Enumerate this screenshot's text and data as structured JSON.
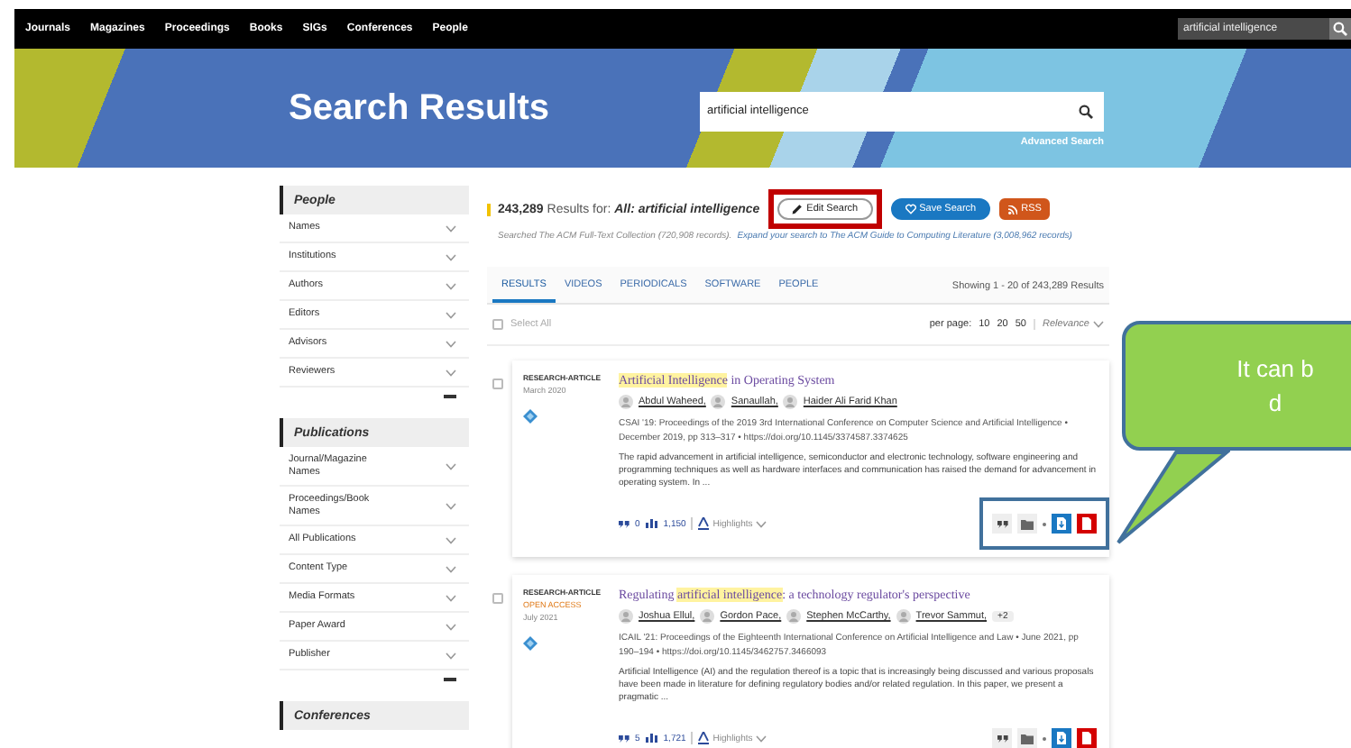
{
  "nav": {
    "links": [
      "Journals",
      "Magazines",
      "Proceedings",
      "Books",
      "SIGs",
      "Conferences",
      "People"
    ],
    "search": {
      "value": "artificial intelligence"
    }
  },
  "banner": {
    "title": "Search Results",
    "search": {
      "value": "artificial intelligence"
    },
    "advanced_link": "Advanced Search"
  },
  "sidebar": {
    "sections": [
      {
        "heading": "People",
        "items": [
          "Names",
          "Institutions",
          "Authors",
          "Editors",
          "Advisors",
          "Reviewers"
        ]
      },
      {
        "heading": "Publications",
        "items": [
          "Journal/Magazine Names",
          "Proceedings/Book Names",
          "All Publications",
          "Content Type",
          "Media Formats",
          "Paper Award",
          "Publisher"
        ]
      },
      {
        "heading": "Conferences"
      }
    ]
  },
  "results": {
    "count": "243,289",
    "label": "Results for:",
    "query": "All: artificial intelligence",
    "buttons": [
      {
        "label": "Edit Search",
        "kind": "edit",
        "highlighted": true
      },
      {
        "label": "Save Search",
        "kind": "save",
        "highlighted": false
      },
      {
        "label": "RSS",
        "kind": "rss",
        "highlighted": false
      }
    ],
    "searched": "Searched The ACM Full-Text Collection (720,908 records).",
    "expand_link": "Expand your search to The ACM Guide to Computing Literature (3,008,962 records)",
    "tabs": [
      {
        "label": "RESULTS",
        "selected": true
      },
      {
        "label": "VIDEOS",
        "selected": false
      },
      {
        "label": "PERIODICALS",
        "selected": false
      },
      {
        "label": "SOFTWARE",
        "selected": false
      },
      {
        "label": "PEOPLE",
        "selected": false
      }
    ],
    "showing": "Showing 1 - 20 of 243,289 Results",
    "select_all": {
      "label": "Select All",
      "checked": false
    },
    "per_page": {
      "label": "per page:",
      "options": [
        "10",
        "20",
        "50"
      ]
    },
    "sort": "Relevance",
    "items": [
      {
        "type": "RESEARCH-ARTICLE",
        "date": "March 2020",
        "checked": false,
        "title": [
          {
            "text": "Artificial Intelligence",
            "highlighted": true
          },
          {
            "text": " in Operating System",
            "highlighted": false
          }
        ],
        "authors": [
          "Abdul Waheed,",
          "Sanaullah,",
          "Haider Ali Farid Khan"
        ],
        "venue": "CSAI '19: Proceedings of the 2019 3rd International Conference on Computer Science and Artificial Intelligence • December 2019, pp 313–317 • https://doi.org/10.1145/3374587.3374625",
        "abstract": "The rapid advancement in artificial intelligence, semiconductor and electronic technology, software engineering and programming techniques as well as hardware interfaces and communication has raised the demand for advancement in operating system. In ...",
        "citations": "0",
        "downloads": "1,150",
        "highlights": "Highlights",
        "actions_highlighted": true
      },
      {
        "type": "RESEARCH-ARTICLE",
        "access": "OPEN ACCESS",
        "date": "July 2021",
        "checked": false,
        "title": [
          {
            "text": "Regulating ",
            "highlighted": false
          },
          {
            "text": "artificial intelligence",
            "highlighted": true
          },
          {
            "text": ": a technology regulator's perspective",
            "highlighted": false
          }
        ],
        "authors": [
          "Joshua Ellul,",
          "Gordon Pace,",
          "Stephen McCarthy,",
          "Trevor Sammut,"
        ],
        "more_authors": "+2",
        "venue": "ICAIL '21: Proceedings of the Eighteenth International Conference on Artificial Intelligence and Law • June 2021, pp 190–194 • https://doi.org/10.1145/3462757.3466093",
        "abstract": "Artificial Intelligence (AI) and the regulation thereof is a topic that is increasingly being discussed and various proposals have been made in literature for defining regulatory bodies and/or related regulation. In this paper, we present a pragmatic ...",
        "citations": "5",
        "downloads": "1,721",
        "highlights": "Highlights",
        "actions_highlighted": false
      }
    ]
  },
  "callout": {
    "lines": [
      "It can b",
      "d"
    ]
  }
}
